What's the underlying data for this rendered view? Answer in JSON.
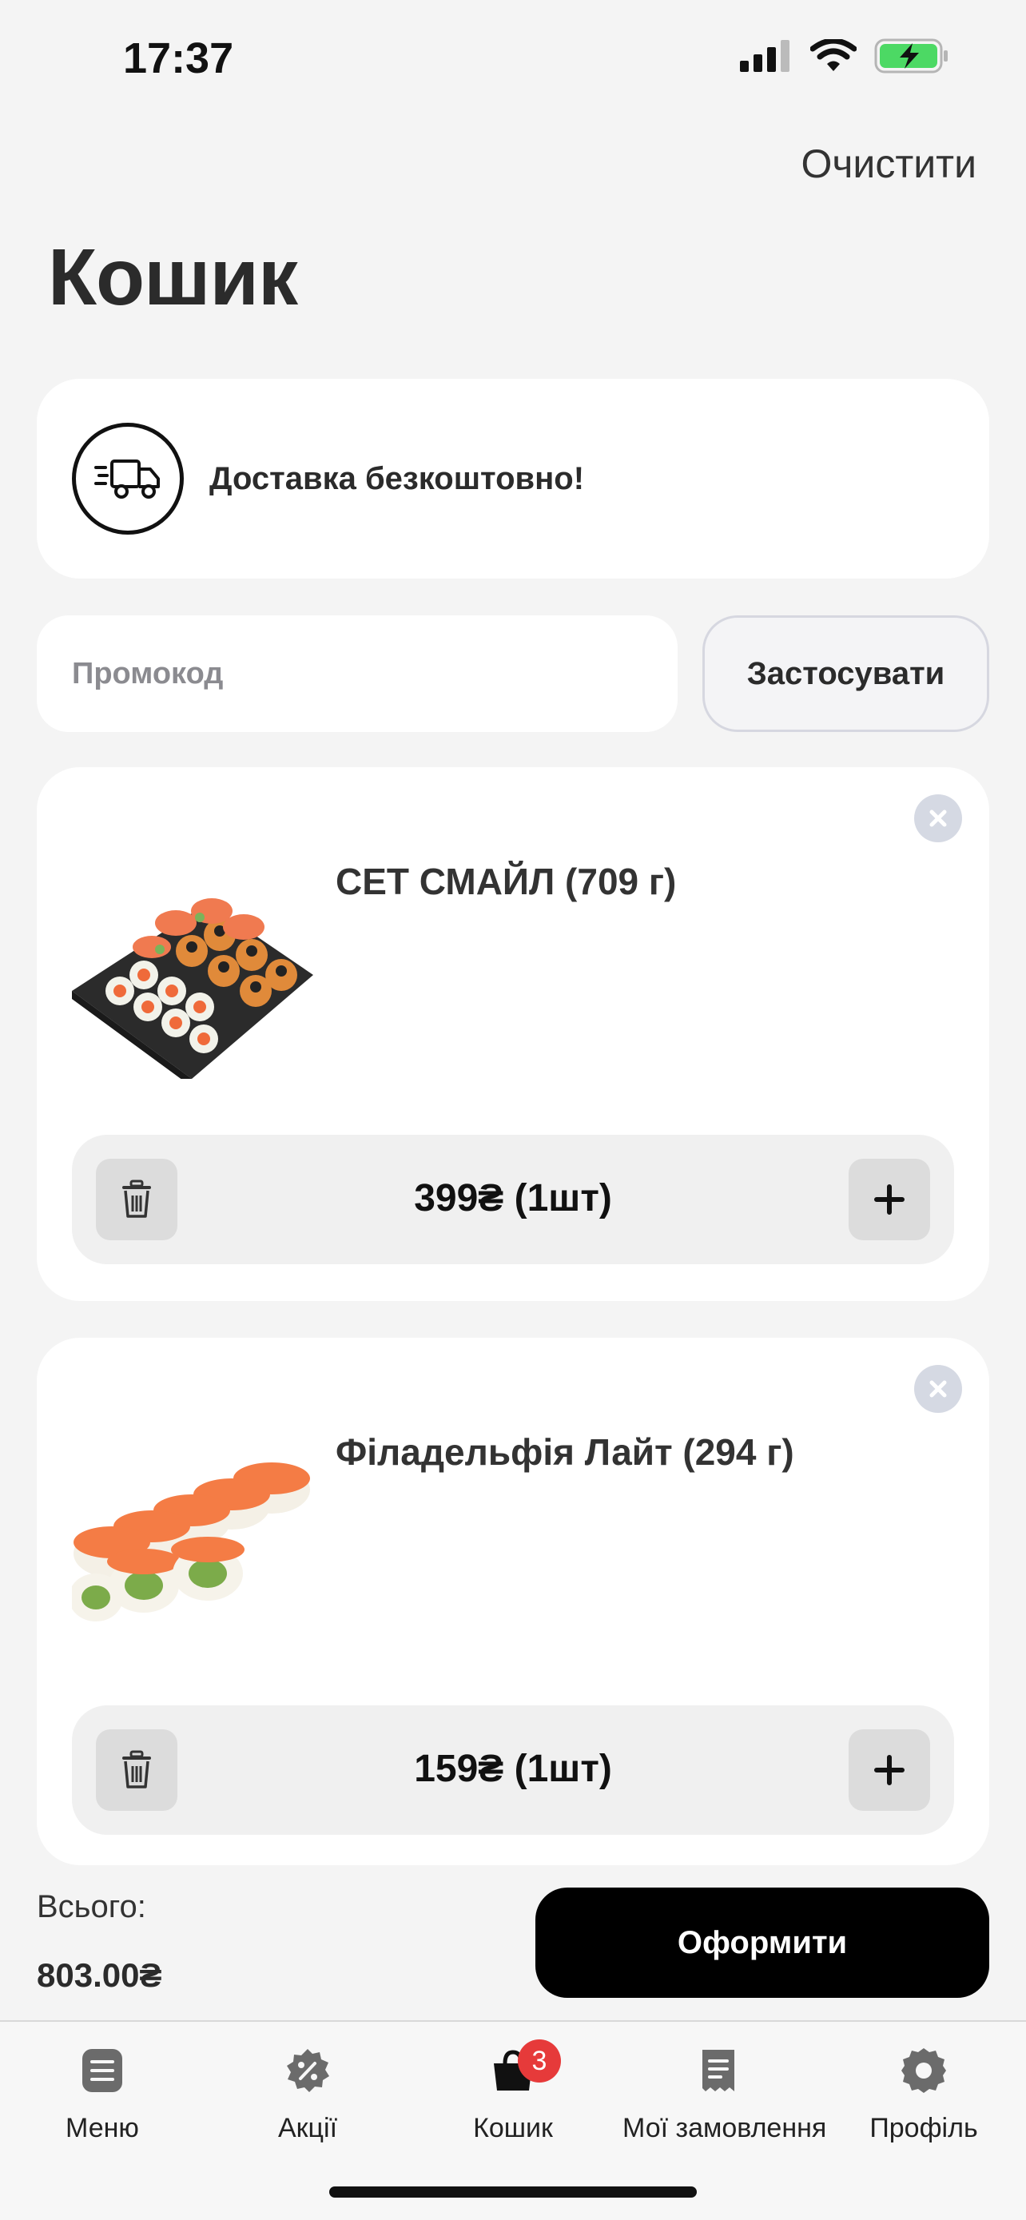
{
  "status": {
    "time": "17:37",
    "icons": [
      "signal-icon",
      "wifi-icon",
      "battery-charging-icon"
    ],
    "battery_color": "#4cd964"
  },
  "header": {
    "clear_label": "Очистити",
    "title": "Кошик"
  },
  "delivery": {
    "icon": "truck-icon",
    "text": "Доставка безкоштовно!"
  },
  "promo": {
    "placeholder": "Промокод",
    "value": "",
    "apply_label": "Застосувати"
  },
  "items": [
    {
      "name": "СЕТ СМАЙЛ (709 г)",
      "price_qty": "399₴  (1шт)",
      "image": "sushi-set-image"
    },
    {
      "name": "Філадельфія Лайт  (294 г)",
      "price_qty": "159₴  (1шт)",
      "image": "philadelphia-roll-image"
    }
  ],
  "footer": {
    "total_label": "Всього:",
    "total_value": "803.00₴",
    "checkout_label": "Оформити"
  },
  "tabbar": {
    "items": [
      {
        "label": "Меню",
        "icon": "menu-icon"
      },
      {
        "label": "Акції",
        "icon": "discount-icon"
      },
      {
        "label": "Кошик",
        "icon": "cart-bag-icon",
        "badge": "3",
        "active": true
      },
      {
        "label": "Мої замовлення",
        "icon": "receipt-icon"
      },
      {
        "label": "Профіль",
        "icon": "profile-icon"
      }
    ]
  },
  "colors": {
    "background": "#f4f4f4",
    "card": "#ffffff",
    "accent": "#000000",
    "badge": "#e63a3a",
    "icon_gray": "#6b6b6b"
  }
}
